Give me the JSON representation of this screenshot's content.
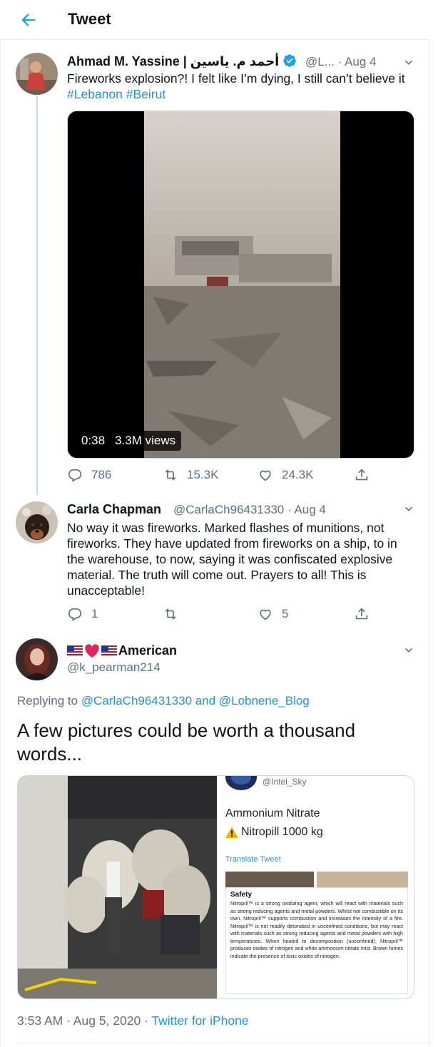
{
  "header": {
    "title": "Tweet"
  },
  "tweet1": {
    "name": "Ahmad M. Yassine | أحمد م. ياسين",
    "handle_date": "@L... · Aug 4",
    "text_plain": "Fireworks explosion?! I felt like I’m dying, I still can’t believe it ",
    "hashtag1": "#Lebanon",
    "hashtag2": "#Beirut",
    "video_duration": "0:38",
    "video_views": "3.3M views",
    "replies": "786",
    "retweets": "15.3K",
    "likes": "24.3K"
  },
  "tweet2": {
    "name": "Carla Chapman",
    "handle_date": "@CarlaCh96431330 · Aug 4",
    "text": "No way it was fireworks.  Marked flashes of munitions, not fireworks.  They have updated from fireworks on a ship, to in the warehouse, to now, saying it was confiscated explosive material.  The truth will come out.  Prayers to all!  This is unacceptable!",
    "replies": "1",
    "retweets": "",
    "likes": "5"
  },
  "tweet3": {
    "name": "American",
    "handle": "@k_pearman214",
    "replying_prefix": "Replying to ",
    "reply_to_1": "@CarlaCh96431330",
    "replying_and": " and ",
    "reply_to_2": "@Lobnene_Blog",
    "text": "A few pictures could be worth a thousand words...",
    "image_card": {
      "handle": "@Intel_Sky",
      "title": "Ammonium Nitrate",
      "subtitle": "Nitropill 1000 kg",
      "translate": "Translate Tweet",
      "safety_heading": "Safety",
      "safety_text": "Nitropril™ is a strong oxidizing agent, which will react with materials such as strong reducing agents and metal powders. Whilst not combustible on its own, Nitropril™ supports combustion and increases the intensity of a fire. Nitropril™ is not readily detonated in unconfined conditions, but may react with materials such as strong reducing agents and metal powders with high temperatures. When heated to decomposition (unconfined), Nitropril™ produces oxides of nitrogen and white ammonium nitrate mist. Brown fumes indicate the presence of toxic oxides of nitrogen."
    },
    "timestamp": "3:53 AM · Aug 5, 2020 · ",
    "source": "Twitter for iPhone"
  },
  "colors": {
    "link": "#1b95e0",
    "muted": "#5b7083",
    "verified": "#1da1f2",
    "heart": "#e0245e"
  },
  "icons": [
    "back-arrow-icon",
    "verified-badge-icon",
    "chevron-down-icon",
    "reply-icon",
    "retweet-icon",
    "like-icon",
    "share-icon",
    "us-flag-icon",
    "red-heart-icon",
    "warning-icon"
  ]
}
